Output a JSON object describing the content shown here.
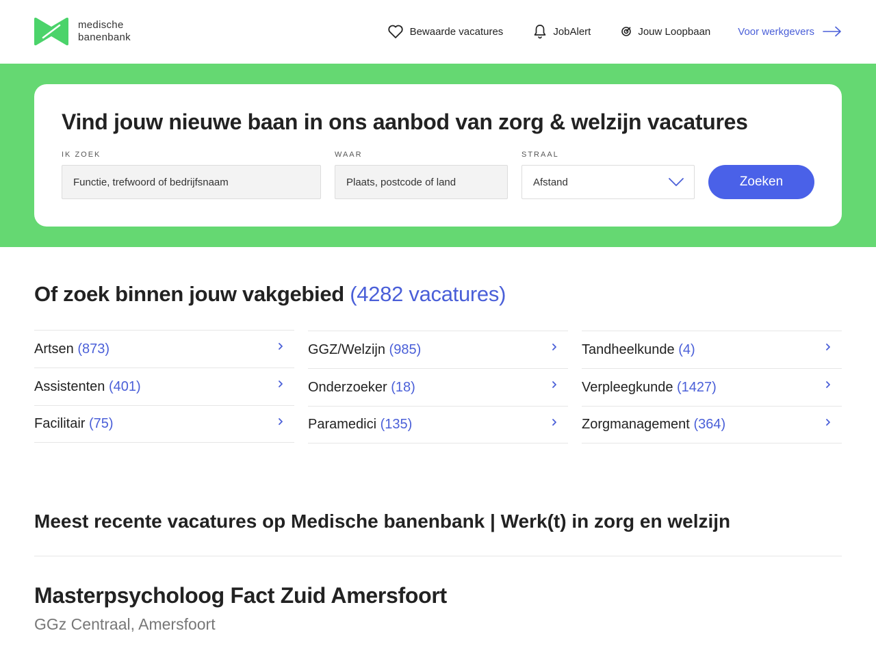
{
  "brand": {
    "line1": "medische",
    "line2": "banenbank",
    "color": "#4bd36a"
  },
  "nav": {
    "saved": "Bewaarde vacatures",
    "jobalert": "JobAlert",
    "career": "Jouw Loopbaan",
    "employers": "Voor werkgevers"
  },
  "hero": {
    "title": "Vind jouw nieuwe baan in ons aanbod van zorg & welzijn vacatures",
    "what_label": "IK ZOEK",
    "what_placeholder": "Functie, trefwoord of bedrijfsnaam",
    "where_label": "WAAR",
    "where_placeholder": "Plaats, postcode of land",
    "radius_label": "STRAAL",
    "radius_value": "Afstand",
    "search_button": "Zoeken"
  },
  "categories": {
    "title": "Of zoek binnen jouw vakgebied",
    "total": "(4282 vacatures)",
    "columns": [
      [
        {
          "name": "Artsen",
          "count": "(873)"
        },
        {
          "name": "Assistenten",
          "count": "(401)"
        },
        {
          "name": "Facilitair",
          "count": "(75)"
        }
      ],
      [
        {
          "name": "GGZ/Welzijn",
          "count": "(985)"
        },
        {
          "name": "Onderzoeker",
          "count": "(18)"
        },
        {
          "name": "Paramedici",
          "count": "(135)"
        }
      ],
      [
        {
          "name": "Tandheelkunde",
          "count": "(4)"
        },
        {
          "name": "Verpleegkunde",
          "count": "(1427)"
        },
        {
          "name": "Zorgmanagement",
          "count": "(364)"
        }
      ]
    ]
  },
  "recent": {
    "title": "Meest recente vacatures op Medische banenbank | Werk(t) in zorg en welzijn",
    "jobs": [
      {
        "title": "Masterpsycholoog Fact Zuid Amersfoort",
        "company": "GGz Centraal, Amersfoort"
      }
    ]
  },
  "colors": {
    "hero_bg": "#65d872",
    "accent": "#4a61e8",
    "link": "#4a5fd8"
  }
}
